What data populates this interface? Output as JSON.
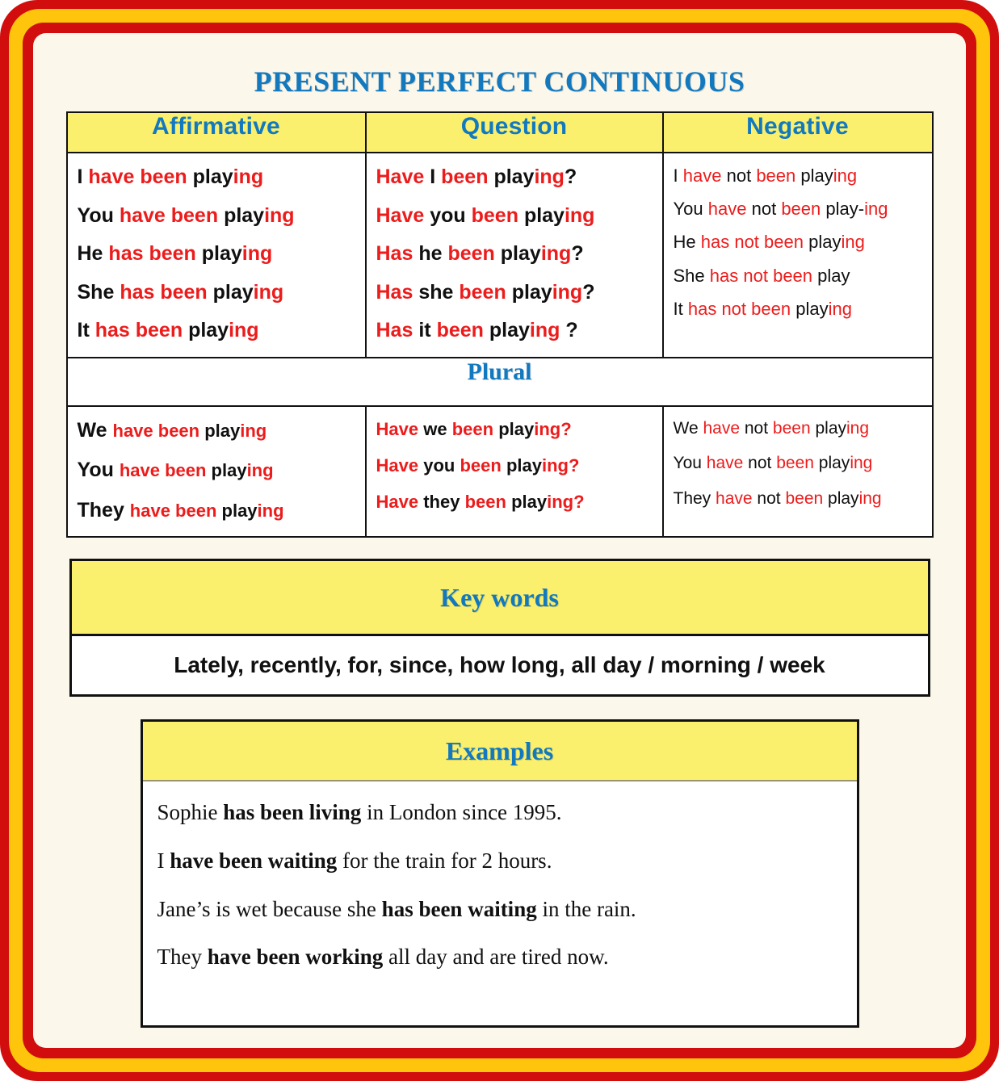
{
  "title": "PRESENT PERFECT CONTINUOUS",
  "colors": {
    "title_blue": "#1279bf",
    "header_yellow": "#faf06e",
    "accent_red": "#ec1c1c",
    "frame_red": "#d10d0d",
    "frame_gold": "#ffc40c",
    "paper_cream": "#fbf7ea"
  },
  "table": {
    "headers": [
      "Affirmative",
      "Question",
      "Negative"
    ],
    "plural_band_label": "Plural",
    "singular": {
      "affirmative": [
        {
          "pronoun": "I",
          "aux": "have been",
          "stem": "play",
          "suffix": "ing",
          "gap": " "
        },
        {
          "pronoun": "You",
          "aux": "have been",
          "stem": "play",
          "suffix": "ing",
          "gap": " "
        },
        {
          "pronoun": "He",
          "aux": "has been",
          "stem": "play",
          "suffix": "ing",
          "gap": "  "
        },
        {
          "pronoun": "She",
          "aux": "has been",
          "stem": "play",
          "suffix": "ing",
          "gap": "  "
        },
        {
          "pronoun": "It",
          "aux": "has been",
          "stem": "play",
          "suffix": "ing",
          "gap": "  "
        }
      ],
      "question": [
        {
          "aux1": "Have",
          "pronoun": "I",
          "aux2": "been",
          "stem": "play",
          "suffix": "ing",
          "mark": "?"
        },
        {
          "aux1": "Have",
          "pronoun": "you",
          "aux2": "been",
          "stem": "play",
          "suffix": "ing",
          "mark": ""
        },
        {
          "aux1": "Has",
          "pronoun": "he",
          "aux2": "been",
          "stem": " play",
          "suffix": "ing",
          "mark": "?"
        },
        {
          "aux1": "Has",
          "pronoun": "she",
          "aux2": "been",
          "stem": "play",
          "suffix": "ing",
          "mark": "?"
        },
        {
          "aux1": "Has",
          "pronoun": "it",
          "aux2": "been",
          "stem": "play",
          "suffix": "ing",
          "mark": " ?"
        }
      ],
      "negative": [
        {
          "pronoun": "I",
          "aux1": "have",
          "neg": "not",
          "aux2": "been",
          "stem": "play",
          "suffix": "ing"
        },
        {
          "pronoun": "You",
          "aux1": "have",
          "neg": "not",
          "aux2": "been",
          "stem": "play-",
          "suffix": "ing"
        },
        {
          "pronoun": "He",
          "aux1": "has not been",
          "neg": "",
          "aux2": "",
          "stem": " play",
          "suffix": "ing"
        },
        {
          "pronoun": "She",
          "aux1": "has not",
          "neg": "",
          "aux2": "been",
          "stem": "play",
          "suffix": ""
        },
        {
          "pronoun": "It",
          "aux1": "has not been",
          "neg": "",
          "aux2": "",
          "stem": "play",
          "suffix": "ing"
        }
      ]
    },
    "plural": {
      "affirmative": [
        {
          "pronoun": "We",
          "aux": "have been",
          "stem": "play",
          "suffix": "ing"
        },
        {
          "pronoun": "You",
          "aux": "have been",
          "stem": "play",
          "suffix": "ing"
        },
        {
          "pronoun": "They",
          "aux": "have been",
          "stem": "play",
          "suffix": "ing"
        }
      ],
      "question": [
        {
          "aux1": "Have",
          "pronoun": "we",
          "aux2": "been",
          "stem": "play",
          "suffix": "ing",
          "mark": "?"
        },
        {
          "aux1": "Have",
          "pronoun": "you",
          "aux2": "been",
          "stem": "play",
          "suffix": "ing",
          "mark": "?"
        },
        {
          "aux1": "Have",
          "pronoun": "they",
          "aux2": "been",
          "stem": "play",
          "suffix": "ing",
          "mark": "?"
        }
      ],
      "negative": [
        {
          "pronoun": "We",
          "aux1": "have",
          "neg": "not",
          "aux2": "been",
          "stem": "play",
          "suffix": "ing"
        },
        {
          "pronoun": "You",
          "aux1": "have",
          "neg": "not",
          "aux2": "been",
          "stem": "play",
          "suffix": "ing"
        },
        {
          "pronoun": "They",
          "aux1": "have",
          "neg": "not",
          "aux2": " been",
          "stem": "play",
          "suffix": "ing"
        }
      ]
    }
  },
  "keywords": {
    "heading": "Key words",
    "text": "Lately, recently, for, since, how long, all day / morning / week"
  },
  "examples": {
    "heading": "Examples",
    "sentences": [
      {
        "before": "Sophie ",
        "bold": "has been living",
        "after": " in London since 1995."
      },
      {
        "before": "I ",
        "bold": "have been waiting",
        "after": " for the train for 2 hours."
      },
      {
        "before": "Jane’s is wet because she ",
        "bold": "has been waiting",
        "after": " in the rain."
      },
      {
        "before": "They ",
        "bold": "have been working",
        "after": " all day and are tired now."
      }
    ]
  }
}
